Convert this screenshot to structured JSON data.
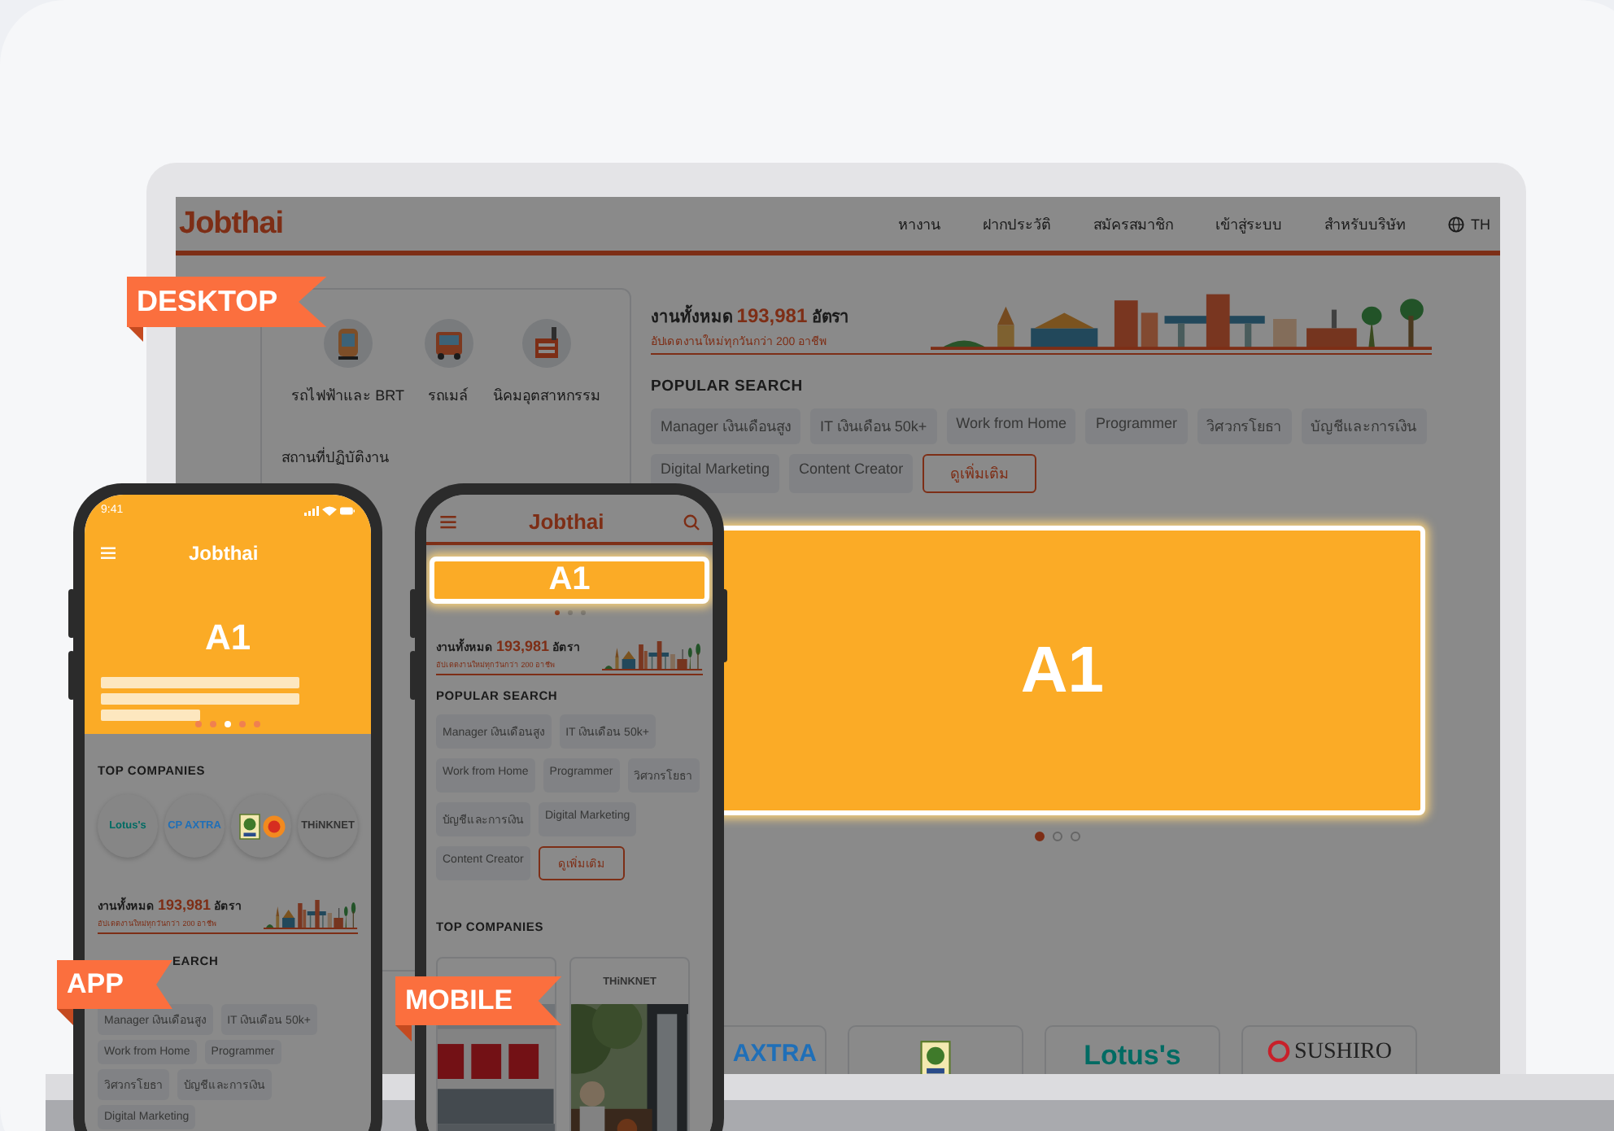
{
  "desktop": {
    "ribbon": "DESKTOP",
    "logo": "Jobthai",
    "nav": [
      {
        "label": "หางาน"
      },
      {
        "label": "ฝากประวัติ"
      },
      {
        "label": "สมัครสมาชิก"
      },
      {
        "label": "เข้าสู่ระบบ"
      },
      {
        "label": "สำหรับบริษัท"
      }
    ],
    "language": "TH",
    "transport": [
      {
        "label": "รถไฟฟ้าและ BRT",
        "kind": "train"
      },
      {
        "label": "รถเมล์",
        "kind": "bus"
      },
      {
        "label": "นิคมอุตสาหกรรม",
        "kind": "factory"
      }
    ],
    "workplace_label": "สถานที่ปฏิบัติงาน",
    "jobs_total": {
      "prefix": "งานทั้งหมด",
      "count": "193,981",
      "suffix": "อัตรา",
      "subtitle": "อัปเดตงานใหม่ทุกวันกว่า 200 อาชีพ"
    },
    "popular_title": "POPULAR SEARCH",
    "tags": [
      {
        "label": "Manager เงินเดือนสูง",
        "kind": "tag"
      },
      {
        "label": "IT เงินเดือน 50k+",
        "kind": "tag"
      },
      {
        "label": "Work from Home",
        "kind": "tag"
      },
      {
        "label": "Programmer",
        "kind": "tag"
      },
      {
        "label": "วิศวกรโยธา",
        "kind": "tag"
      },
      {
        "label": "บัญชีและการเงิน",
        "kind": "tag"
      },
      {
        "label": "Digital Marketing",
        "kind": "tag"
      },
      {
        "label": "Content Creator",
        "kind": "tag"
      },
      {
        "label": "ดูเพิ่มเติม",
        "kind": "more"
      }
    ],
    "banner": "A1",
    "dots": [
      {
        "selected": true
      },
      {
        "selected": false
      },
      {
        "selected": false
      }
    ],
    "companies": [
      {
        "kind": "wordmark",
        "name": "AXTRA",
        "color": "#1f6fb8"
      },
      {
        "kind": "emblem"
      },
      {
        "kind": "wordmark",
        "name": "Lotus's",
        "color": "#006b63"
      },
      {
        "kind": "ring-wordmark",
        "name": "SUSHIRO",
        "color": "#222222"
      }
    ]
  },
  "app": {
    "ribbon": "APP",
    "time": "9:41",
    "logo": "Jobthai",
    "banner": "A1",
    "dots": [
      {
        "selected": false
      },
      {
        "selected": false
      },
      {
        "selected": true
      },
      {
        "selected": false
      },
      {
        "selected": false
      }
    ],
    "top_companies_title": "TOP COMPANIES",
    "companies": [
      {
        "kind": "wordmark",
        "name": "Lotus's",
        "color": "#006b63"
      },
      {
        "kind": "wordmark",
        "name": "CP AXTRA",
        "color": "#1f6fb8"
      },
      {
        "kind": "emblem"
      },
      {
        "kind": "wordmark",
        "name": "THiNKNET",
        "color": "#333333"
      }
    ],
    "jobs_total": {
      "prefix": "งานทั้งหมด",
      "count": "193,981",
      "suffix": "อัตรา",
      "subtitle": "อัปเดตงานใหม่ทุกวันกว่า 200 อาชีพ"
    },
    "popular_title": "EARCH",
    "tags": [
      {
        "label": "Manager เงินเดือนสูง",
        "kind": "tag"
      },
      {
        "label": "IT เงินเดือน 50k+",
        "kind": "tag"
      },
      {
        "label": "Work from Home",
        "kind": "tag"
      },
      {
        "label": "Programmer",
        "kind": "tag"
      },
      {
        "label": "วิศวกรโยธา",
        "kind": "tag"
      },
      {
        "label": "บัญชีและการเงิน",
        "kind": "tag"
      },
      {
        "label": "Digital Marketing",
        "kind": "tag"
      }
    ]
  },
  "mobile": {
    "ribbon": "MOBILE",
    "logo": "Jobthai",
    "banner": "A1",
    "dots": [
      {
        "selected": true
      },
      {
        "selected": false
      },
      {
        "selected": false
      }
    ],
    "jobs_total": {
      "prefix": "งานทั้งหมด",
      "count": "193,981",
      "suffix": "อัตรา",
      "subtitle": "อัปเดตงานใหม่ทุกวันกว่า 200 อาชีพ"
    },
    "popular_title": "POPULAR SEARCH",
    "tags": [
      {
        "label": "Manager เงินเดือนสูง",
        "kind": "tag"
      },
      {
        "label": "IT เงินเดือน 50k+",
        "kind": "tag"
      },
      {
        "label": "Work from Home",
        "kind": "tag"
      },
      {
        "label": "Programmer",
        "kind": "tag"
      },
      {
        "label": "วิศวกรโยธา",
        "kind": "tag"
      },
      {
        "label": "บัญชีและการเงิน",
        "kind": "tag"
      },
      {
        "label": "Digital Marketing",
        "kind": "tag"
      },
      {
        "label": "Content Creator",
        "kind": "tag"
      },
      {
        "label": "ดูเพิ่มเติม",
        "kind": "more"
      }
    ],
    "top_companies_title": "TOP COMPANIES",
    "company_cards": [
      {
        "kind": "picture"
      },
      {
        "kind": "wordmark",
        "name": "THiNKNET",
        "color": "#333333"
      }
    ]
  }
}
